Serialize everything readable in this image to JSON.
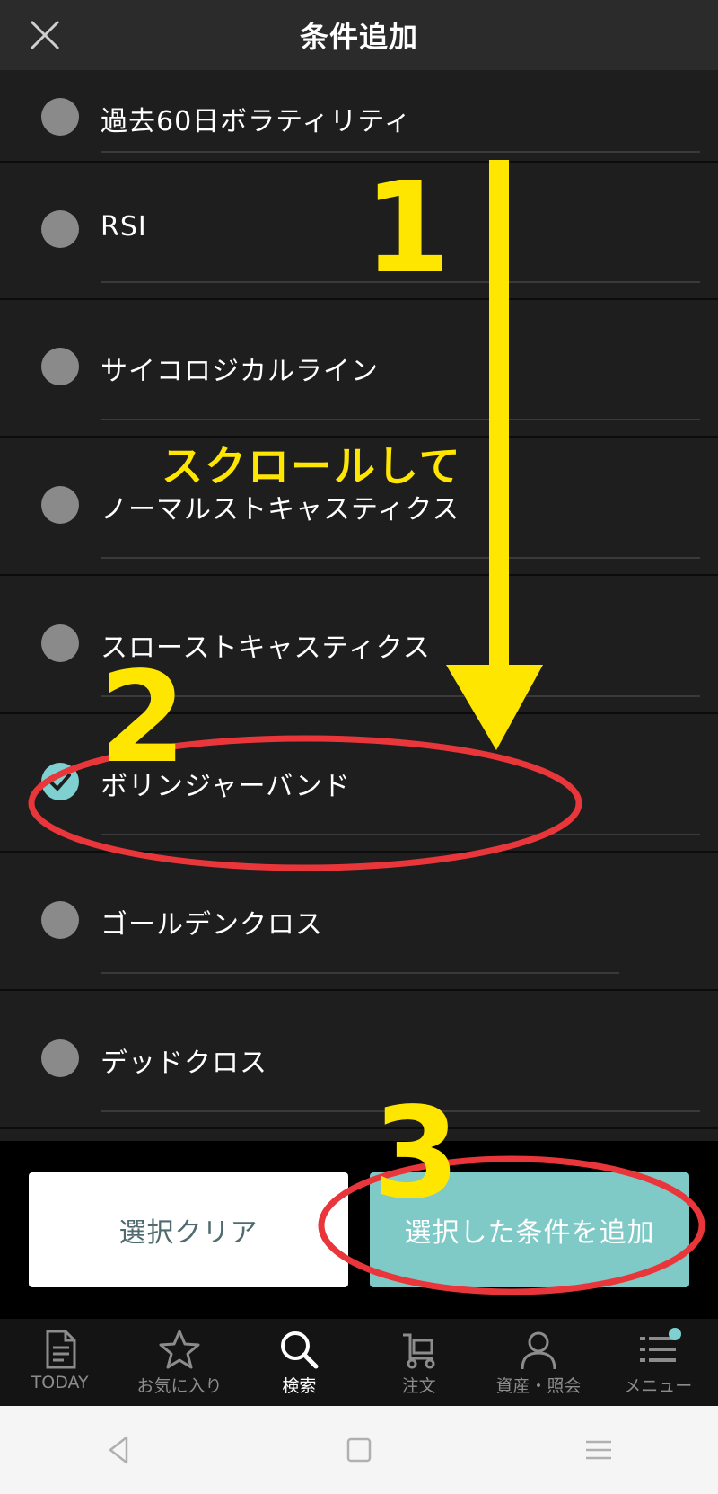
{
  "header": {
    "title": "条件追加",
    "close_icon": "close-icon"
  },
  "conditions": [
    {
      "label": "過去60日ボラティリティ",
      "checked": false
    },
    {
      "label": "RSI",
      "checked": false
    },
    {
      "label": "サイコロジカルライン",
      "checked": false
    },
    {
      "label": "ノーマルストキャスティクス",
      "checked": false
    },
    {
      "label": "スローストキャスティクス",
      "checked": false
    },
    {
      "label": "ボリンジャーバンド",
      "checked": true
    },
    {
      "label": "ゴールデンクロス",
      "checked": false
    },
    {
      "label": "デッドクロス",
      "checked": false
    }
  ],
  "buttons": {
    "clear": "選択クリア",
    "add": "選択した条件を追加"
  },
  "tabs": [
    {
      "label": "TODAY",
      "icon": "document-icon",
      "active": false
    },
    {
      "label": "お気に入り",
      "icon": "star-icon",
      "active": false
    },
    {
      "label": "検索",
      "icon": "search-icon",
      "active": true
    },
    {
      "label": "注文",
      "icon": "cart-icon",
      "active": false
    },
    {
      "label": "資産・照会",
      "icon": "person-icon",
      "active": false
    },
    {
      "label": "メニュー",
      "icon": "menu-icon",
      "active": false,
      "badge": true
    }
  ],
  "annotations": {
    "step1": "1",
    "step2": "2",
    "step3": "3",
    "scroll_text": "スクロールして"
  },
  "colors": {
    "accent": "#7fd0d0",
    "annotation_yellow": "#ffe600",
    "annotation_red": "#e8363a"
  }
}
